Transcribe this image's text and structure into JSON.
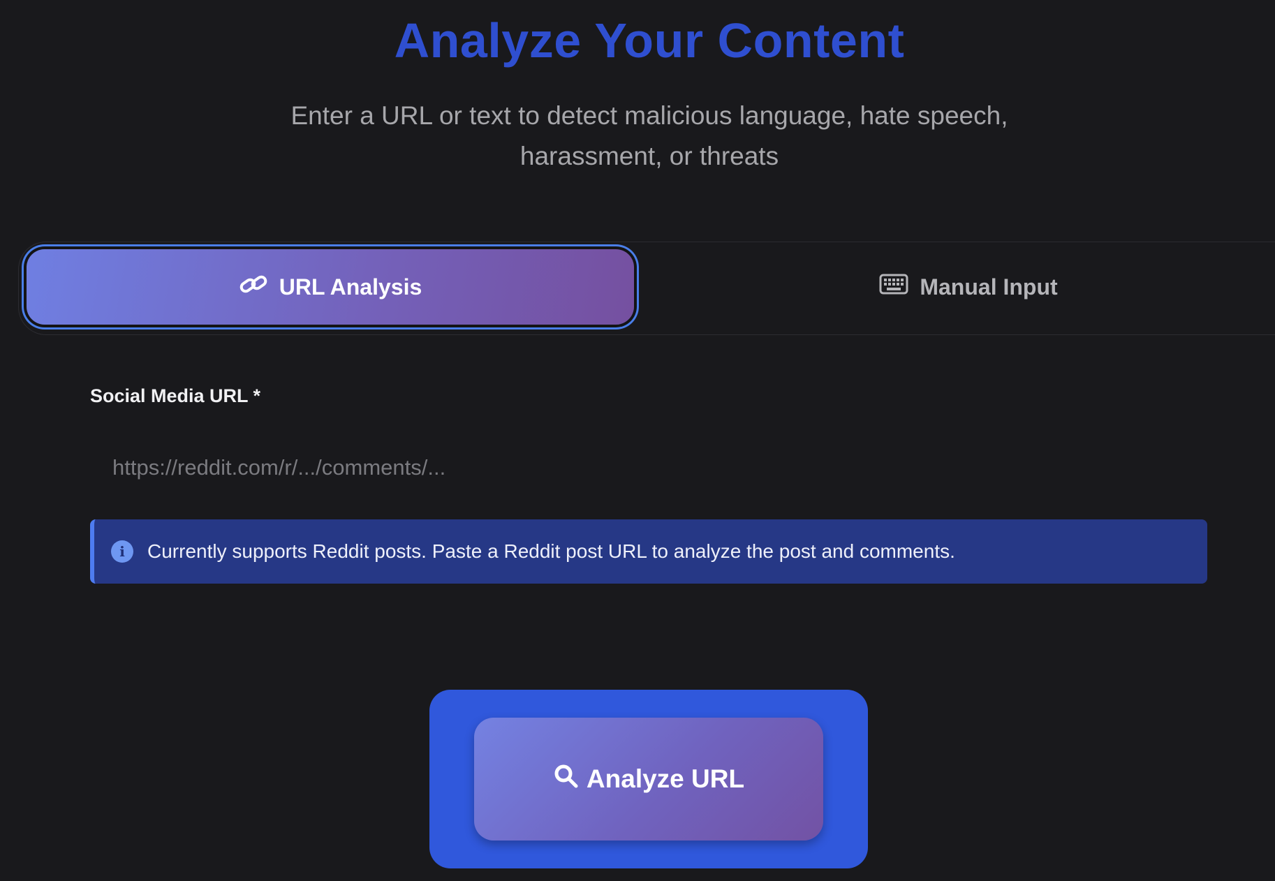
{
  "header": {
    "title": "Analyze Your Content",
    "subtitle_line1": "Enter a URL or text to detect malicious language, hate speech,",
    "subtitle_line2": "harassment, or threats"
  },
  "tabs": [
    {
      "label": "URL Analysis",
      "icon": "link-icon",
      "active": true
    },
    {
      "label": "Manual Input",
      "icon": "keyboard-icon",
      "active": false
    }
  ],
  "form": {
    "url_label": "Social Media URL *",
    "url_value": "",
    "url_placeholder": "https://reddit.com/r/.../comments/..."
  },
  "info": {
    "icon": "info-icon",
    "text": "Currently supports Reddit posts. Paste a Reddit post URL to analyze the post and comments."
  },
  "action": {
    "label": "Analyze URL",
    "icon": "search-icon"
  },
  "colors": {
    "background": "#19191c",
    "title": "#2f4fd0",
    "info_bg": "#263886",
    "cta_frame": "#3058dc"
  }
}
